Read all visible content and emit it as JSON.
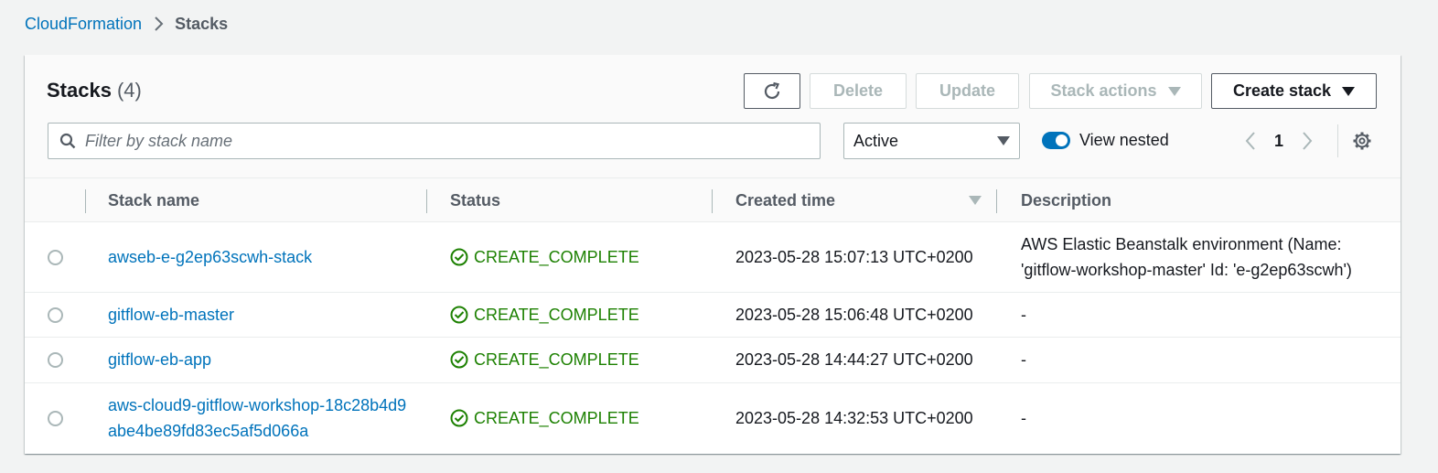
{
  "breadcrumb": {
    "parent": "CloudFormation",
    "current": "Stacks"
  },
  "panel": {
    "title": "Stacks",
    "count": "(4)",
    "buttons": {
      "delete": "Delete",
      "update": "Update",
      "stack_actions": "Stack actions",
      "create_stack": "Create stack"
    },
    "search_placeholder": "Filter by stack name",
    "status_filter": "Active",
    "view_nested_label": "View nested",
    "view_nested_enabled": true,
    "page": "1"
  },
  "table": {
    "columns": {
      "name": "Stack name",
      "status": "Status",
      "created": "Created time",
      "description": "Description"
    },
    "rows": [
      {
        "name": "awseb-e-g2ep63scwh-stack",
        "status": "CREATE_COMPLETE",
        "created": "2023-05-28 15:07:13 UTC+0200",
        "description": "AWS Elastic Beanstalk environment (Name: 'gitflow-workshop-master' Id: 'e-g2ep63scwh')"
      },
      {
        "name": "gitflow-eb-master",
        "status": "CREATE_COMPLETE",
        "created": "2023-05-28 15:06:48 UTC+0200",
        "description": "-"
      },
      {
        "name": "gitflow-eb-app",
        "status": "CREATE_COMPLETE",
        "created": "2023-05-28 14:44:27 UTC+0200",
        "description": "-"
      },
      {
        "name": "aws-cloud9-gitflow-workshop-18c28b4d9abe4be89fd83ec5af5d066a",
        "status": "CREATE_COMPLETE",
        "created": "2023-05-28 14:32:53 UTC+0200",
        "description": "-"
      }
    ]
  },
  "colors": {
    "link": "#0073bb",
    "success": "#1d8102",
    "toggle": "#0073bb"
  }
}
